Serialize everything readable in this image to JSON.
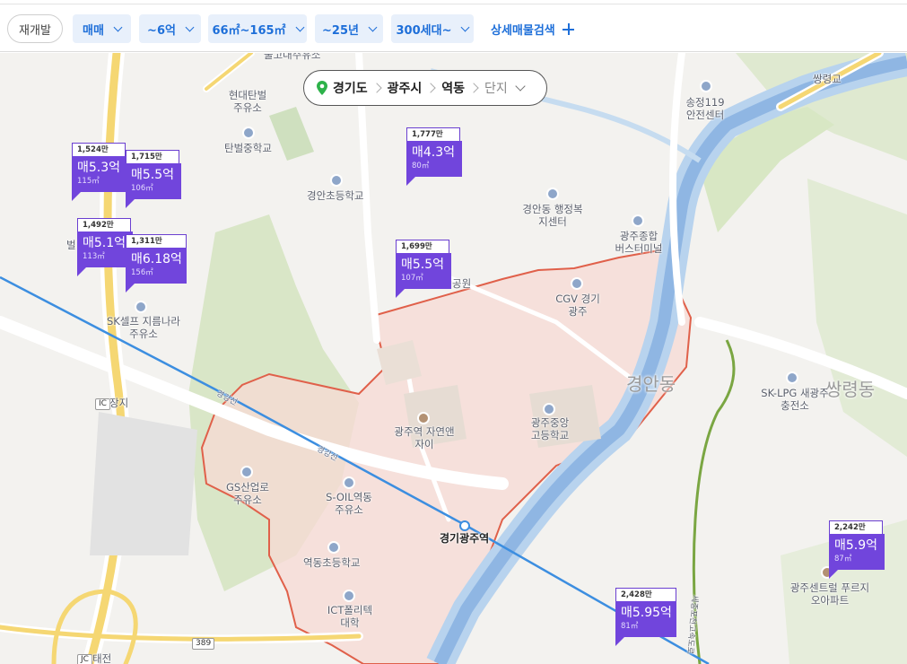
{
  "filters": {
    "reset_label": "재개발",
    "chips": [
      {
        "label": "매매"
      },
      {
        "label": "~6억"
      },
      {
        "label": "66㎡~165㎡"
      },
      {
        "label": "~25년"
      },
      {
        "label": "300세대~"
      }
    ],
    "detail_label": "상세매물검색"
  },
  "breadcrumb": {
    "items": [
      "경기도",
      "광주시",
      "역동"
    ],
    "last": "단지"
  },
  "colors": {
    "accent": "#1e6fd9",
    "marker": "#7145dc",
    "district_fill": "#f7d9d4",
    "district_border": "#e0604a",
    "river": "#6e9bd6",
    "rail": "#3c8ee0"
  },
  "map_labels": {
    "top_cut": "물고대주유소",
    "ssangryeonggyo": "쌍령교",
    "station119": "송정119 안전센터",
    "hyundai": "현대탄벌 주유소",
    "tanbeol_school": "탄벌중학교",
    "gyeongan_school": "경안초등학교",
    "gyeongan_center": "경안동 행정복지센터",
    "bus_terminal": "광주종합 버스터미널",
    "park": "공원",
    "cgv": "CGV 경기광주",
    "gyeongan_dong": "경안동",
    "ssangryeong_dong": "쌍령동",
    "sk_lpg": "SK-LPG 새광주충전소",
    "sk_self": "SK셀프 지름나라주유소",
    "ic_jangji": "장지",
    "ic_tag": "IC",
    "station_apt": "광주역 자연앤자이",
    "high_school": "광주중앙 고등학교",
    "gs": "GS산업로 주유소",
    "soil": "S-OIL역동 주유소",
    "yeokdong_school": "역동초등학교",
    "station": "경기광주역",
    "ict": "ICT폴리텍 대학",
    "sentrel": "광주센트럴 푸르지오아파트",
    "route389": "389",
    "jc_tag": "JC",
    "jc": "태전",
    "rail_label": "경강선",
    "expressway": "세종포천고속도로",
    "partial_bal": "벌"
  },
  "listings": [
    {
      "unit_price": "1,524만",
      "price": "매5.3억",
      "size": "115㎡"
    },
    {
      "unit_price": "1,715만",
      "price": "매5.5억",
      "size": "106㎡"
    },
    {
      "unit_price": "1,777만",
      "price": "매4.3억",
      "size": "80㎡"
    },
    {
      "unit_price": "1,492만",
      "price": "매5.1억",
      "size": "113㎡"
    },
    {
      "unit_price": "1,311만",
      "price": "매6.18억",
      "size": "156㎡"
    },
    {
      "unit_price": "1,699만",
      "price": "매5.5억",
      "size": "107㎡"
    },
    {
      "unit_price": "2,242만",
      "price": "매5.9억",
      "size": "87㎡"
    },
    {
      "unit_price": "2,428만",
      "price": "매5.95억",
      "size": "81㎡"
    }
  ]
}
